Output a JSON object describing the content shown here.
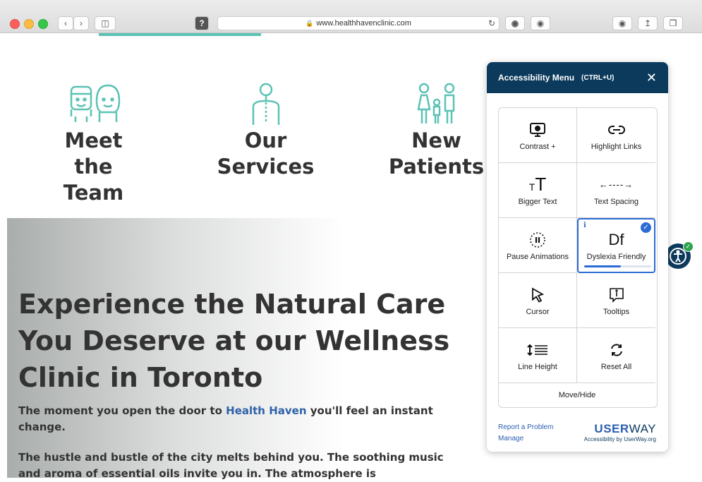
{
  "browser": {
    "url": "www.healthhavenclinic.com",
    "lock_icon": "lock-icon",
    "reload_icon": "reload-icon"
  },
  "site": {
    "cards": [
      {
        "line1": "Meet",
        "line2": "the Team",
        "icon": "team-icon"
      },
      {
        "line1": "Our",
        "line2": "Services",
        "icon": "spine-icon"
      },
      {
        "line1": "New",
        "line2": "Patients",
        "icon": "family-icon"
      }
    ],
    "hero": {
      "headline": "Experience the Natural Care You Deserve at our Wellness Clinic in Toronto",
      "p1_before": "The moment you open the door to ",
      "p1_brand": "Health Haven",
      "p1_after": " you'll feel an instant change.",
      "p2": "The hustle and bustle of the city melts behind you. The soothing music and aroma of essential oils invite you in. The atmosphere is"
    }
  },
  "a11y": {
    "title": "Accessibility Menu",
    "shortcut": "(CTRL+U)",
    "close": "✕",
    "tiles": [
      {
        "label": "Contrast +",
        "icon": "contrast-icon"
      },
      {
        "label": "Highlight Links",
        "icon": "link-icon"
      },
      {
        "label": "Bigger Text",
        "icon": "text-size-icon"
      },
      {
        "label": "Text Spacing",
        "icon": "spacing-icon"
      },
      {
        "label": "Pause Animations",
        "icon": "pause-icon"
      },
      {
        "label": "Dyslexia Friendly",
        "icon": "dyslexia-icon",
        "active": true,
        "progress": 0.55
      },
      {
        "label": "Cursor",
        "icon": "cursor-icon"
      },
      {
        "label": "Tooltips",
        "icon": "tooltip-icon"
      },
      {
        "label": "Line Height",
        "icon": "line-height-icon"
      },
      {
        "label": "Reset All",
        "icon": "reset-icon"
      }
    ],
    "dyslexia_glyph": "Df",
    "bigger_text_glyph_small": "T",
    "bigger_text_glyph_big": "T",
    "spacing_glyph": "←----→",
    "move_hide": "Move/Hide",
    "report": "Report a Problem",
    "manage": "Manage",
    "brand_bold": "USER",
    "brand_light": "WAY",
    "brand_by": "Accessibility by UserWay.org"
  },
  "colors": {
    "header": "#0c3a5c",
    "accent": "#2b6bd6",
    "teal": "#5cc2b5"
  }
}
